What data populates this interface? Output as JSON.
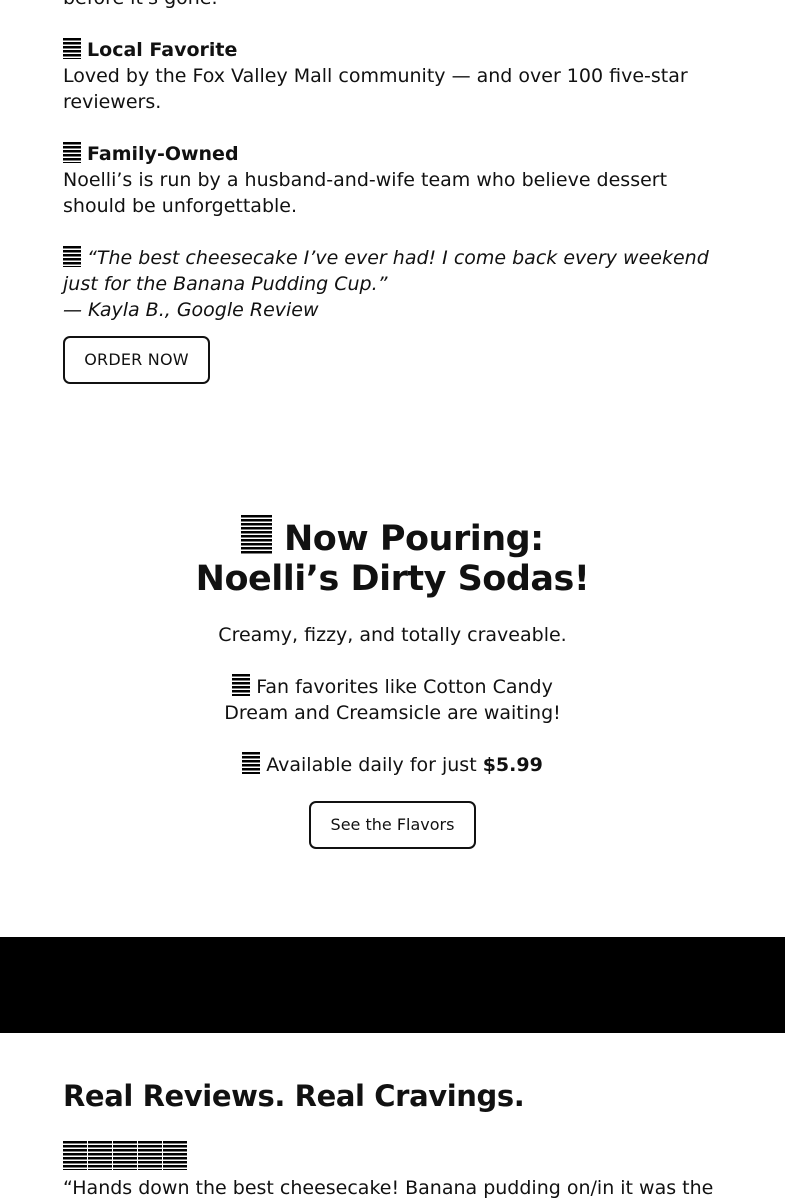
{
  "intro": {
    "cut_text": "before it's gone."
  },
  "features": [
    {
      "icon": "trophy-icon",
      "title": "Local Favorite",
      "body": "Loved by the Fox Valley Mall community — and over 100 five-star reviewers."
    },
    {
      "icon": "family-icon",
      "title": "Family-Owned",
      "body": "Noelli’s is run by a husband-and-wife team who believe dessert should be unforgettable."
    }
  ],
  "testimonial": {
    "icon": "speech-bubble-icon",
    "quote": "“The best cheesecake I’ve ever had! I come back every weekend just for the Banana Pudding Cup.”",
    "attribution": "— Kayla B., Google Review"
  },
  "order_button": "ORDER NOW",
  "soda": {
    "icon": "soda-cup-icon",
    "title_line1": "Now Pouring:",
    "title_line2": "Noelli’s Dirty Sodas!",
    "tagline": "Creamy, fizzy, and totally craveable.",
    "fan_icon": "heart-icon",
    "fan_text": "Fan favorites like Cotton Candy Dream and Creamsicle are waiting!",
    "avail_icon": "money-icon",
    "avail_text": "Available daily for just ",
    "price": "$5.99",
    "button": "See the Flavors"
  },
  "reviews": {
    "title": "Real Reviews. Real Cravings.",
    "rating": 5,
    "first_review": "“Hands down the best cheesecake! Banana pudding on/in it was the"
  }
}
